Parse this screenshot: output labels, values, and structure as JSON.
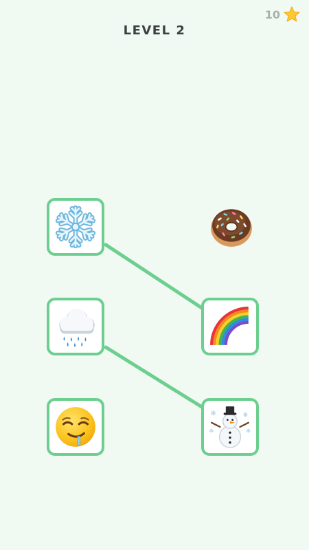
{
  "header": {
    "level_title": "LEVEL 2",
    "star_count": "10",
    "star_icon": "star-icon"
  },
  "colors": {
    "background": "#f1f9f3",
    "tile_border": "#6ccf8f",
    "link_line": "#6ccf8f",
    "title_text": "#3c4043",
    "star_count_text": "#a9b0ac",
    "star": "#ffc933"
  },
  "board": {
    "left_column": [
      {
        "emoji": "snowflake",
        "framed": true
      },
      {
        "emoji": "cloud-with-rain",
        "framed": true
      },
      {
        "emoji": "drooling-face",
        "framed": true
      }
    ],
    "right_column": [
      {
        "emoji": "doughnut",
        "framed": false
      },
      {
        "emoji": "rainbow",
        "framed": true
      },
      {
        "emoji": "snowman",
        "framed": true
      }
    ],
    "links": [
      {
        "from": "snowflake",
        "to": "rainbow"
      },
      {
        "from": "cloud-with-rain",
        "to": "snowman"
      }
    ]
  }
}
